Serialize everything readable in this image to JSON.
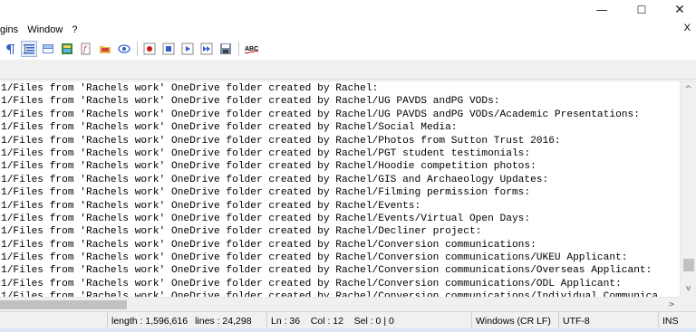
{
  "window": {
    "minimize_glyph": "—",
    "maximize_glyph": "☐",
    "close_glyph": "✕"
  },
  "menubar": {
    "items": [
      "gins",
      "Window",
      "?"
    ],
    "close_doc": "X"
  },
  "toolbar": {
    "icons": [
      "show-all-characters-icon",
      "indent-guide-icon",
      "user-defined-language-icon",
      "document-map-icon",
      "function-list-icon",
      "folder-as-workspace-icon",
      "monitoring-icon",
      "start-recording-icon",
      "stop-recording-icon",
      "playback-icon",
      "run-macro-multiple-icon",
      "save-macro-icon",
      "spell-check-icon"
    ],
    "spell_check_label": "ABC"
  },
  "editor": {
    "lines": [
      "1/Files from 'Rachels work' OneDrive folder created by Rachel:",
      "1/Files from 'Rachels work' OneDrive folder created by Rachel/UG PAVDS andPG VODs:",
      "1/Files from 'Rachels work' OneDrive folder created by Rachel/UG PAVDS andPG VODs/Academic Presentations:",
      "1/Files from 'Rachels work' OneDrive folder created by Rachel/Social Media:",
      "1/Files from 'Rachels work' OneDrive folder created by Rachel/Photos from Sutton Trust 2016:",
      "1/Files from 'Rachels work' OneDrive folder created by Rachel/PGT student testimonials:",
      "1/Files from 'Rachels work' OneDrive folder created by Rachel/Hoodie competition photos:",
      "1/Files from 'Rachels work' OneDrive folder created by Rachel/GIS and Archaeology Updates:",
      "1/Files from 'Rachels work' OneDrive folder created by Rachel/Filming permission forms:",
      "1/Files from 'Rachels work' OneDrive folder created by Rachel/Events:",
      "1/Files from 'Rachels work' OneDrive folder created by Rachel/Events/Virtual Open Days:",
      "1/Files from 'Rachels work' OneDrive folder created by Rachel/Decliner project:",
      "1/Files from 'Rachels work' OneDrive folder created by Rachel/Conversion communications:",
      "1/Files from 'Rachels work' OneDrive folder created by Rachel/Conversion communications/UKEU Applicant:",
      "1/Files from 'Rachels work' OneDrive folder created by Rachel/Conversion communications/Overseas Applicant:",
      "1/Files from 'Rachels work' OneDrive folder created by Rachel/Conversion communications/ODL Applicant:",
      "1/Files from 'Rachels work' OneDrive folder created by Rachel/Conversion communications/Individual Communica"
    ],
    "scroll_up_glyph": "^",
    "scroll_down_glyph": "v",
    "scroll_right_glyph": ">"
  },
  "statusbar": {
    "length": "length : 1,596,616",
    "lines": "lines : 24,298",
    "position": "Ln : 36    Col : 12    Sel : 0 | 0",
    "eol": "Windows (CR LF)",
    "encoding": "UTF-8",
    "mode": "INS"
  },
  "colors": {
    "statusbar_bg": "#f0f0f0",
    "editor_bg": "#ffffff",
    "record_red": "#d01818",
    "macro_blue": "#3060c8"
  }
}
